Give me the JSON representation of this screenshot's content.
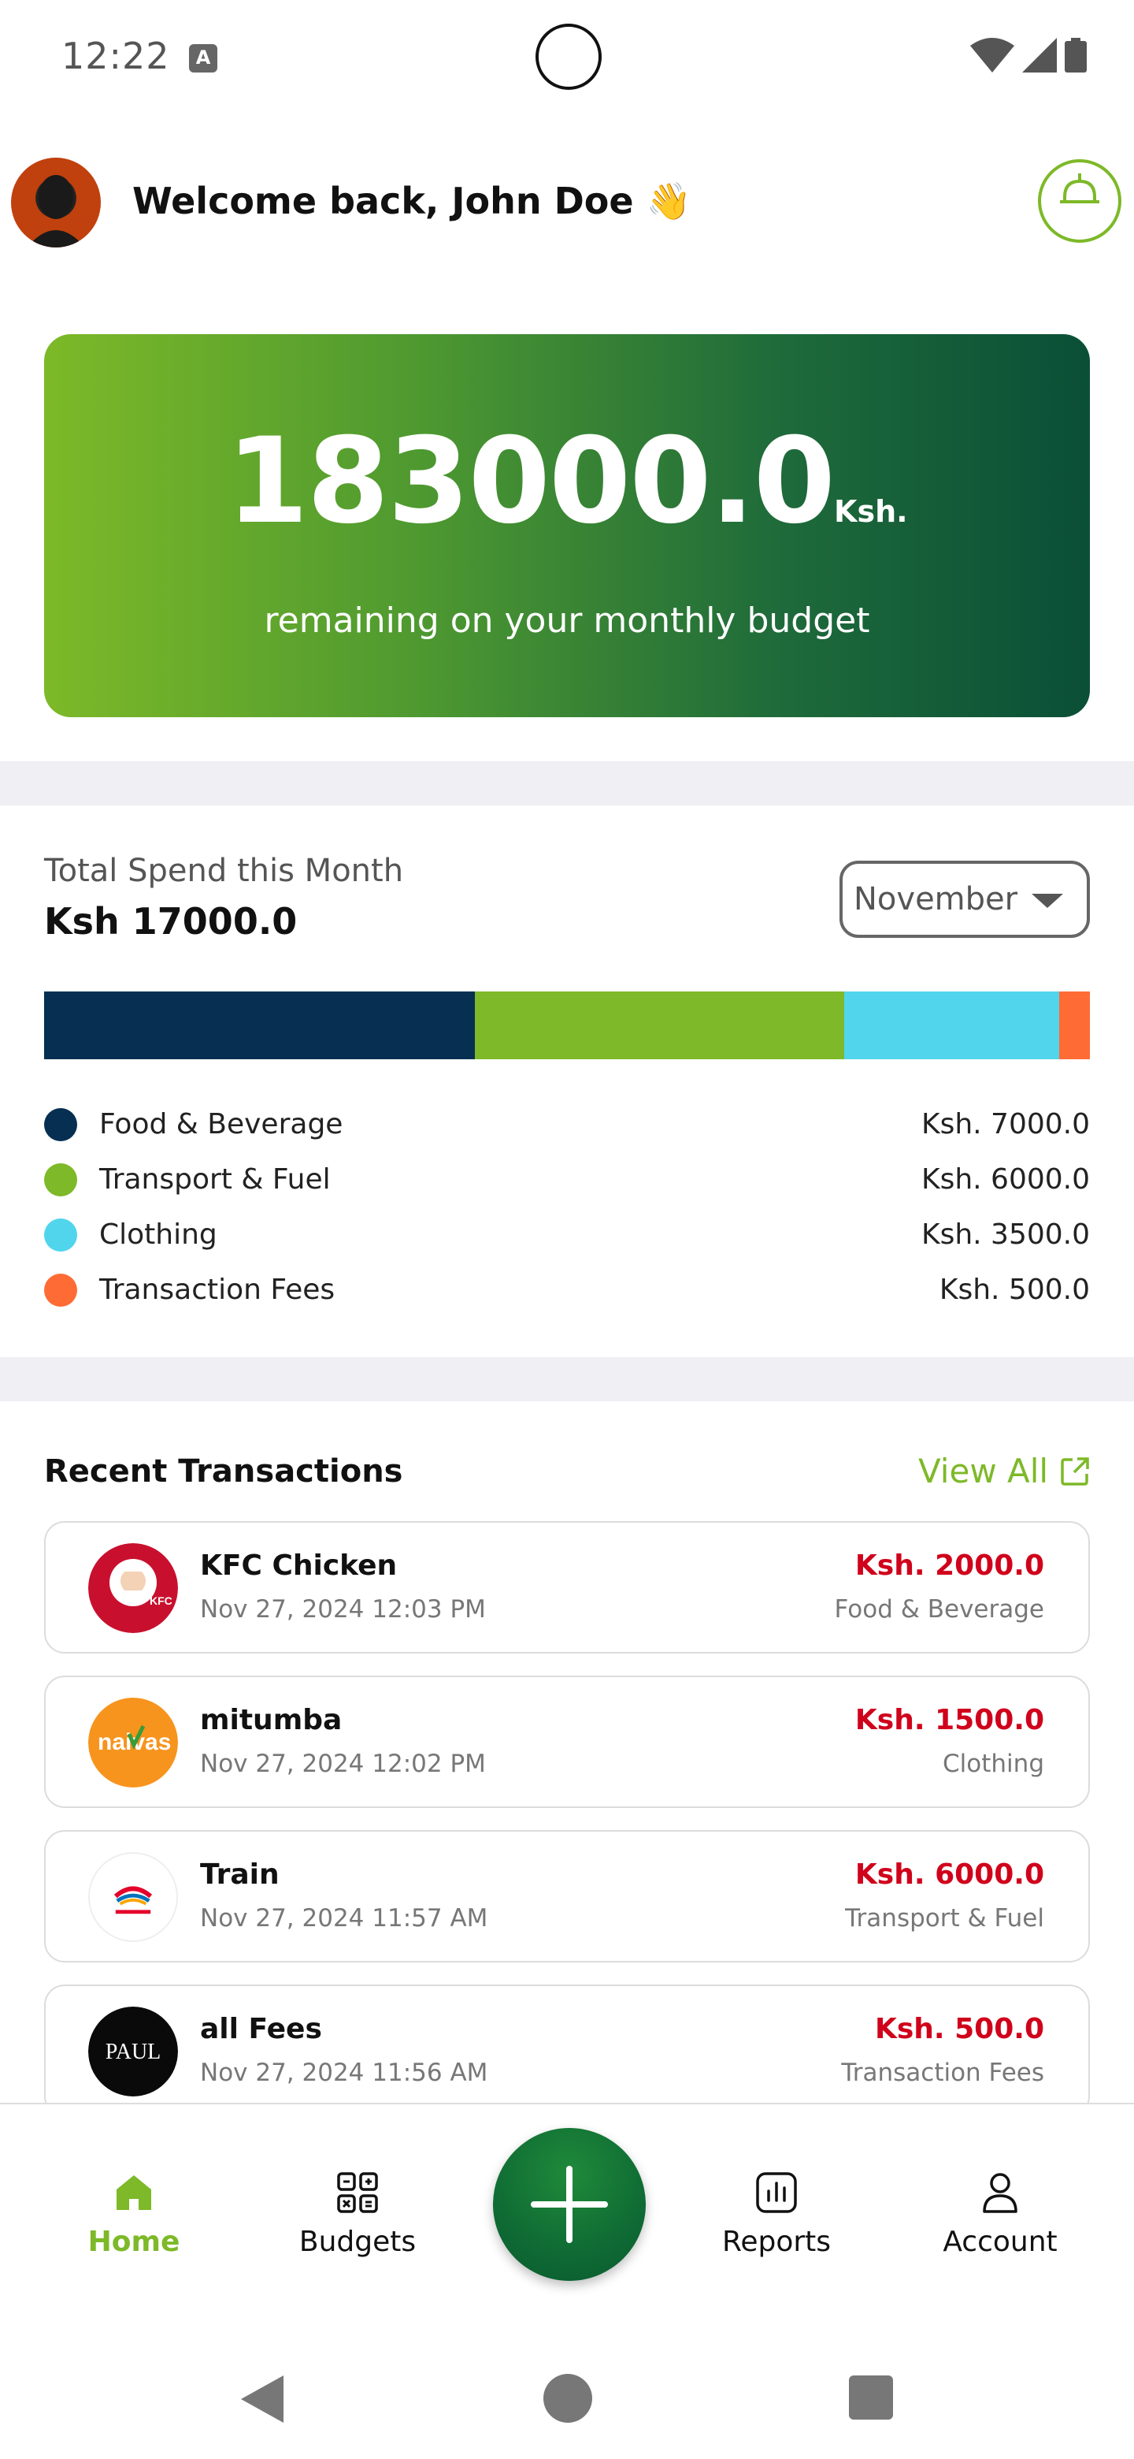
{
  "status_bar": {
    "time": "12:22",
    "notification_glyph": "A"
  },
  "header": {
    "welcome": "Welcome back, John Doe 👋"
  },
  "balance": {
    "amount": "183000.0",
    "currency": "Ksh.",
    "subtitle": "remaining on your monthly budget"
  },
  "spend": {
    "label": "Total Spend this Month",
    "total": "Ksh 17000.0",
    "month": "November",
    "categories": [
      {
        "name": "Food & Beverage",
        "value": "Ksh. 7000.0",
        "amount": 7000,
        "color": "#062f52"
      },
      {
        "name": "Transport & Fuel",
        "value": "Ksh. 6000.0",
        "amount": 6000,
        "color": "#7db928"
      },
      {
        "name": "Clothing",
        "value": "Ksh. 3500.0",
        "amount": 3500,
        "color": "#50d5ec"
      },
      {
        "name": "Transaction Fees",
        "value": "Ksh. 500.0",
        "amount": 500,
        "color": "#ff6b35"
      }
    ]
  },
  "transactions": {
    "title": "Recent Transactions",
    "view_all": "View All",
    "items": [
      {
        "name": "KFC Chicken",
        "date": "Nov 27, 2024 12:03 PM",
        "amount": "Ksh. 2000.0",
        "category": "Food & Beverage",
        "logo": "kfc-logo"
      },
      {
        "name": "mitumba",
        "date": "Nov 27, 2024 12:02 PM",
        "amount": "Ksh. 1500.0",
        "category": "Clothing",
        "logo": "naivas-logo"
      },
      {
        "name": "Train",
        "date": "Nov 27, 2024 11:57 AM",
        "amount": "Ksh. 6000.0",
        "category": "Transport & Fuel",
        "logo": "total-energies-logo"
      },
      {
        "name": "all Fees",
        "date": "Nov 27, 2024 11:56 AM",
        "amount": "Ksh. 500.0",
        "category": "Transaction Fees",
        "logo": "paul-logo"
      }
    ]
  },
  "nav": {
    "home": "Home",
    "budgets": "Budgets",
    "reports": "Reports",
    "account": "Account"
  },
  "colors": {
    "accent": "#7db928",
    "expense": "#d0021b",
    "card_start": "#7db928",
    "card_end": "#0a4f37"
  }
}
